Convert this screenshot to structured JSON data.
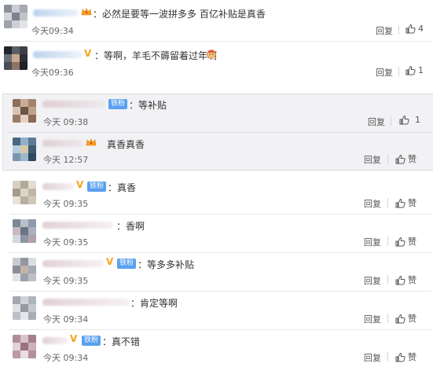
{
  "comments": [
    {
      "text": "：必然是要等一波拼多多 百亿补贴是真香",
      "time": "今天09:34",
      "reply": "回复",
      "likes": "4"
    },
    {
      "text": "：等啊，羊毛不薅留着过年啊",
      "time": "今天09:36",
      "reply": "回复",
      "likes": "1"
    }
  ],
  "replies": [
    {
      "badge": "铁粉",
      "text": "：等补贴",
      "time": "今天 09:38",
      "reply": "回复",
      "likes": "1"
    },
    {
      "text": "真香真香",
      "time": "今天 12:57",
      "reply": "回复",
      "likes": "赞"
    },
    {
      "badge": "铁粉",
      "text": "：真香",
      "time": "今天 09:35",
      "reply": "回复",
      "likes": "赞"
    },
    {
      "text": "：香啊",
      "time": "今天 09:35",
      "reply": "回复",
      "likes": "赞"
    },
    {
      "badge": "铁粉",
      "text": "：等多多补贴",
      "time": "今天 09:35",
      "reply": "回复",
      "likes": "赞"
    },
    {
      "text": "：肯定等啊",
      "time": "今天 09:34",
      "reply": "回复",
      "likes": "赞"
    },
    {
      "badge": "铁粉",
      "text": "：真不错",
      "time": "今天 09:34",
      "reply": "回复",
      "likes": "赞"
    }
  ],
  "colors": {
    "vip": "#f5a21b",
    "fan_badge": "#5aa0f0",
    "panel_bg": "#f2f2f5"
  },
  "icons": {
    "like": "thumbs-up-icon",
    "vip": "vip-v-icon",
    "crown": "crown-icon"
  }
}
